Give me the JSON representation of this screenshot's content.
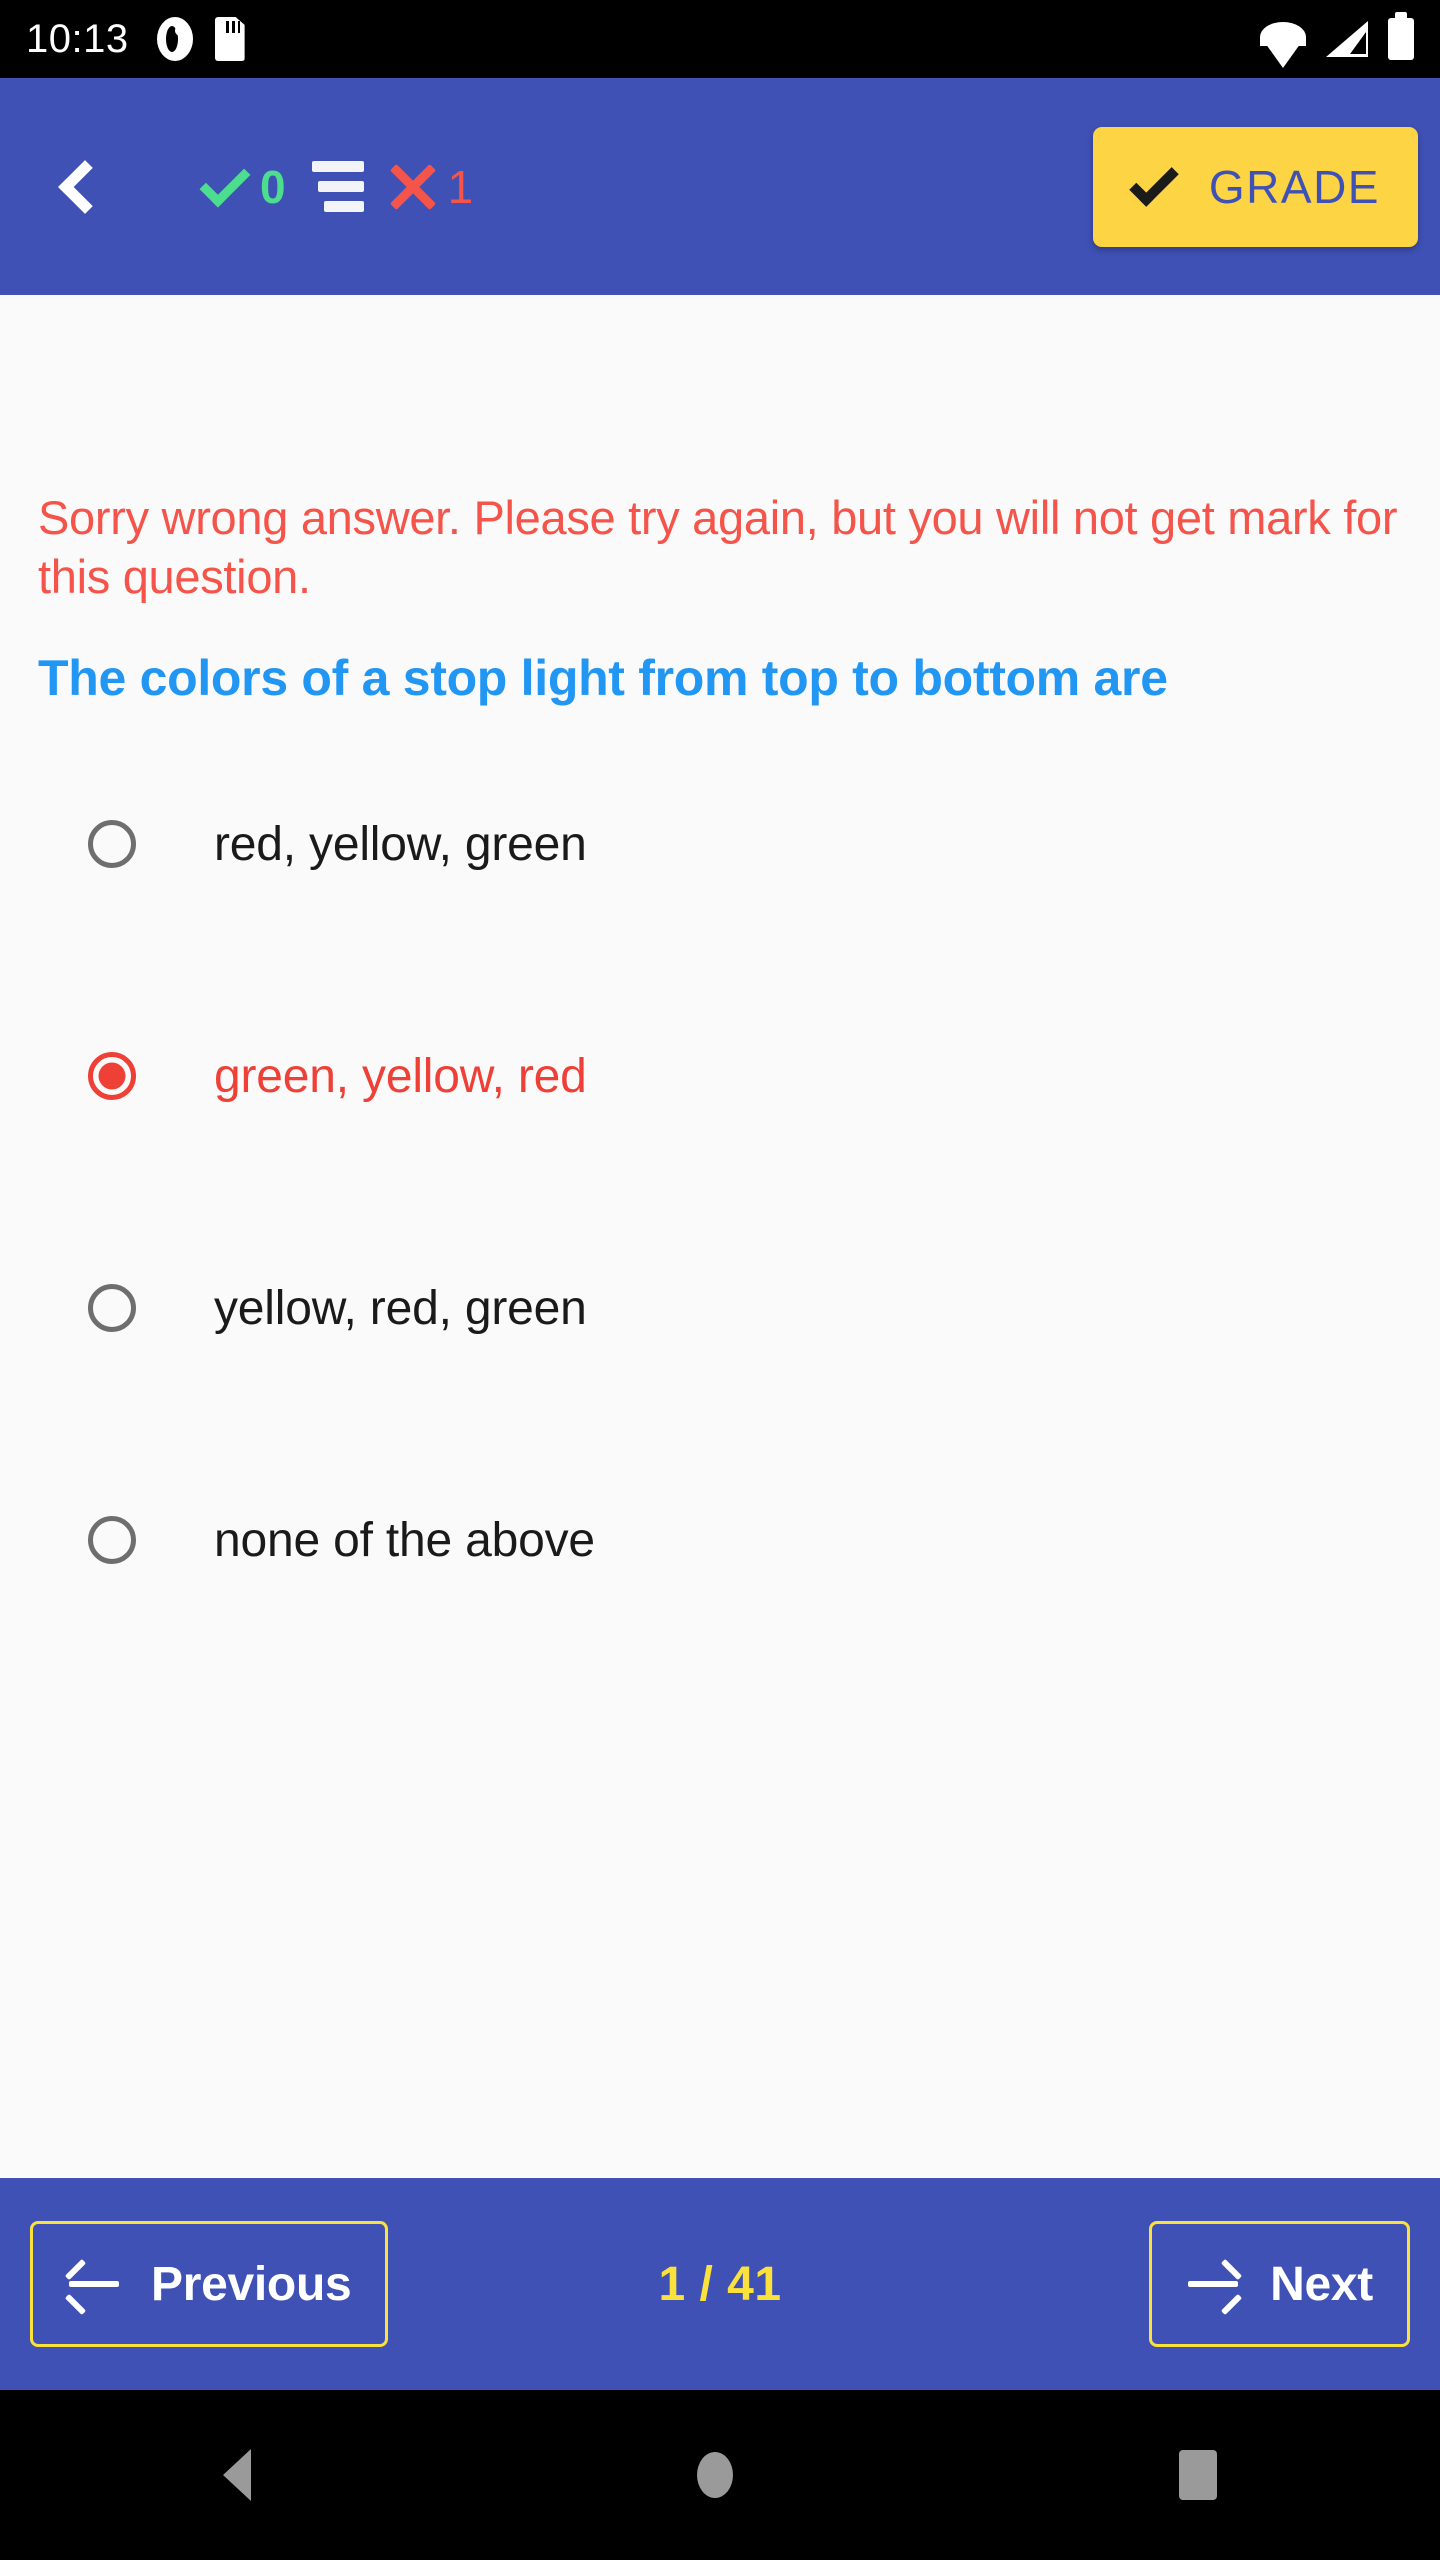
{
  "statusbar": {
    "time": "10:13",
    "left_icons": [
      "face-icon",
      "sdcard-icon"
    ],
    "right_icons": [
      "wifi-icon",
      "signal-icon",
      "battery-icon"
    ]
  },
  "appbar": {
    "back_icon": "chevron-left-icon",
    "correct_count": "0",
    "wrong_count": "1",
    "list_icon": "list-lines-icon",
    "grade_label": "GRADE",
    "grade_check_icon": "check-icon",
    "background_color": "#3F51B5",
    "grade_bg_color": "#FCD444",
    "grade_text_color": "#3F51B5",
    "correct_color": "#4CDD8F",
    "wrong_color": "#F4544A"
  },
  "content": {
    "feedback": "Sorry wrong answer. Please try again, but you will not get mark for this question.",
    "feedback_color": "#F4544A",
    "question": "The colors of a stop light from top to bottom are",
    "question_color": "#2196F3",
    "options": [
      {
        "label": "red, yellow, green",
        "selected": false
      },
      {
        "label": "green, yellow, red",
        "selected": true
      },
      {
        "label": "yellow, red, green",
        "selected": false
      },
      {
        "label": "none of the above",
        "selected": false
      }
    ],
    "selected_color": "#EE4036",
    "unselected_color": "#6E6E6E",
    "background_color": "#FAFAFA"
  },
  "bottombar": {
    "previous_label": "Previous",
    "previous_icon": "arrow-left-icon",
    "next_label": "Next",
    "next_icon": "arrow-right-icon",
    "page_counter": "1 / 41",
    "counter_color": "#FBE13C",
    "border_color": "#FBE13C",
    "background_color": "#3F51B5"
  },
  "androidnav": {
    "back_icon": "triangle-back-icon",
    "home_icon": "circle-home-icon",
    "recents_icon": "square-recents-icon"
  }
}
